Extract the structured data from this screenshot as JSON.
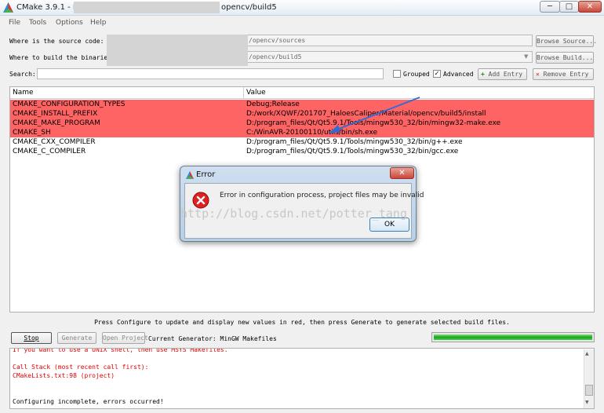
{
  "window": {
    "title": "CMake 3.9.1 - D",
    "title_suffix": "opencv/build5",
    "controls": {
      "minimize": "─",
      "maximize": "□",
      "close": "✕"
    }
  },
  "menu": [
    "File",
    "Tools",
    "Options",
    "Help"
  ],
  "source": {
    "label": "Where is the source code:",
    "value": "/opencv/sources",
    "button": "Browse Source..."
  },
  "build": {
    "label": "Where to build the binaries:",
    "value": "/opencv/build5",
    "button": "Browse Build..."
  },
  "search": {
    "label": "Search:",
    "value": ""
  },
  "options": {
    "grouped_label": "Grouped",
    "grouped_checked": false,
    "advanced_label": "Advanced",
    "advanced_checked": true
  },
  "entry_buttons": {
    "add": "Add Entry",
    "remove": "Remove Entry"
  },
  "table": {
    "columns": [
      "Name",
      "Value"
    ],
    "rows": [
      {
        "name": "CMAKE_CONFIGURATION_TYPES",
        "value": "Debug;Release",
        "is_new": true
      },
      {
        "name": "CMAKE_INSTALL_PREFIX",
        "value": "D:/work/XQWF/201707_HaloesCaliper/Material/opencv/build5/install",
        "is_new": true
      },
      {
        "name": "CMAKE_MAKE_PROGRAM",
        "value": "D:/program_files/Qt/Qt5.9.1/Tools/mingw530_32/bin/mingw32-make.exe",
        "is_new": true
      },
      {
        "name": "CMAKE_SH",
        "value": "C:/WinAVR-20100110/utils/bin/sh.exe",
        "is_new": true
      },
      {
        "name": "CMAKE_CXX_COMPILER",
        "value": "D:/program_files/Qt/Qt5.9.1/Tools/mingw530_32/bin/g++.exe",
        "is_new": false
      },
      {
        "name": "CMAKE_C_COMPILER",
        "value": "D:/program_files/Qt/Qt5.9.1/Tools/mingw530_32/bin/gcc.exe",
        "is_new": false
      }
    ]
  },
  "hint": "Press Configure to update and display new values in red, then press Generate to generate selected build files.",
  "actions": {
    "stop": "Stop",
    "generate": "Generate",
    "open_project": "Open Project",
    "generator_label": "Current Generator: MinGW Makefiles"
  },
  "progress": 1.0,
  "log": [
    {
      "text": "  If you want to use a UNIX shell, then use MSYS Makefiles.",
      "error": true
    },
    {
      "text": "",
      "error": false
    },
    {
      "text": "Call Stack (most recent call first):",
      "error": true
    },
    {
      "text": "  CMakeLists.txt:98 (project)",
      "error": true
    },
    {
      "text": "",
      "error": false
    },
    {
      "text": "",
      "error": false
    },
    {
      "text": "Configuring incomplete, errors occurred!",
      "error": false
    }
  ],
  "dialog": {
    "title": "Error",
    "message": "Error in configuration process, project files may be invalid",
    "ok": "OK",
    "close": "✕"
  },
  "watermark": "http://blog.csdn.net/potter_tang",
  "colors": {
    "new_row": "#ff6464",
    "log_error": "#e00000",
    "progress": "#1aa31a"
  }
}
